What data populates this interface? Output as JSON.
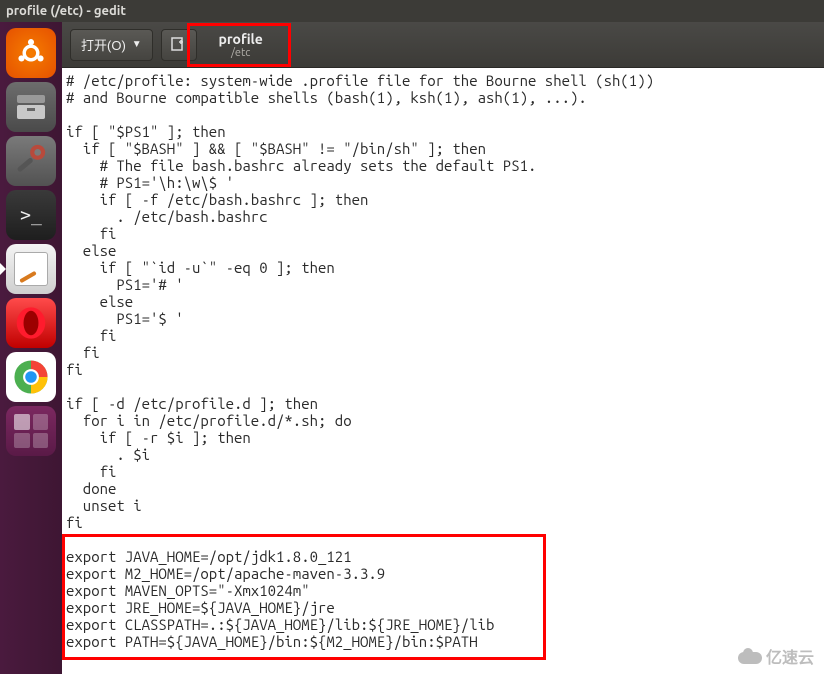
{
  "window": {
    "title": "profile (/etc) - gedit"
  },
  "toolbar": {
    "open_label": "打开(O)",
    "document_name": "profile",
    "document_path": "/etc"
  },
  "launcher": {
    "items": [
      {
        "name": "ubuntu-dash"
      },
      {
        "name": "files"
      },
      {
        "name": "system-settings"
      },
      {
        "name": "terminal"
      },
      {
        "name": "text-editor"
      },
      {
        "name": "opera"
      },
      {
        "name": "chrome"
      },
      {
        "name": "workspace-switcher"
      }
    ]
  },
  "code": {
    "lines": [
      "# /etc/profile: system-wide .profile file for the Bourne shell (sh(1))",
      "# and Bourne compatible shells (bash(1), ksh(1), ash(1), ...).",
      "",
      "if [ \"$PS1\" ]; then",
      "  if [ \"$BASH\" ] && [ \"$BASH\" != \"/bin/sh\" ]; then",
      "    # The file bash.bashrc already sets the default PS1.",
      "    # PS1='\\h:\\w\\$ '",
      "    if [ -f /etc/bash.bashrc ]; then",
      "      . /etc/bash.bashrc",
      "    fi",
      "  else",
      "    if [ \"`id -u`\" -eq 0 ]; then",
      "      PS1='# '",
      "    else",
      "      PS1='$ '",
      "    fi",
      "  fi",
      "fi",
      "",
      "if [ -d /etc/profile.d ]; then",
      "  for i in /etc/profile.d/*.sh; do",
      "    if [ -r $i ]; then",
      "      . $i",
      "    fi",
      "  done",
      "  unset i",
      "fi",
      "",
      "export JAVA_HOME=/opt/jdk1.8.0_121",
      "export M2_HOME=/opt/apache-maven-3.3.9",
      "export MAVEN_OPTS=\"-Xmx1024m\"",
      "export JRE_HOME=${JAVA_HOME}/jre",
      "export CLASSPATH=.:${JAVA_HOME}/lib:${JRE_HOME}/lib",
      "export PATH=${JAVA_HOME}/bin:${M2_HOME}/bin:$PATH"
    ]
  },
  "watermark": {
    "text": "亿速云"
  }
}
